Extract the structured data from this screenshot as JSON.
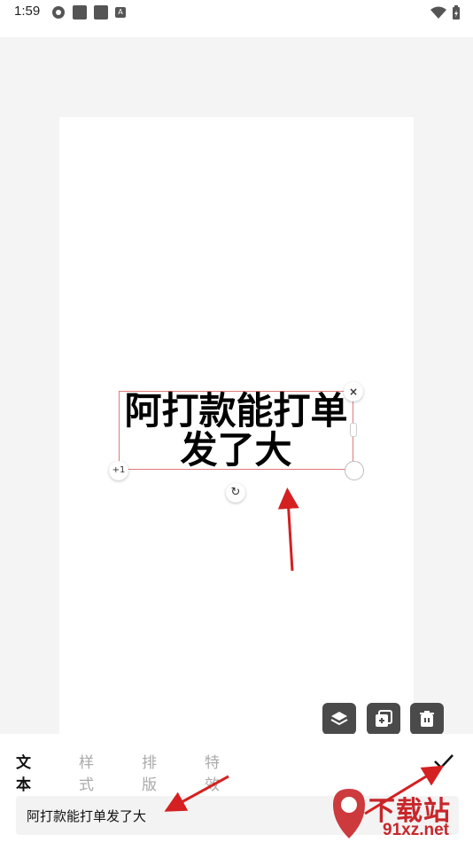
{
  "status_bar": {
    "time": "1:59",
    "notification_letter": "A"
  },
  "canvas": {
    "text_element": {
      "line1": "阿打款能打单",
      "line2": "发了大"
    },
    "handles": {
      "close": "×",
      "plus": "+1",
      "rotate": "↻"
    }
  },
  "toolbar_icons": [
    "layers-icon",
    "duplicate-icon",
    "delete-icon"
  ],
  "bottom_panel": {
    "tabs": [
      {
        "label": "文本",
        "active": true
      },
      {
        "label": "样式",
        "active": false
      },
      {
        "label": "排版",
        "active": false
      },
      {
        "label": "特效",
        "active": false
      }
    ],
    "input_value": "阿打款能打单发了大"
  },
  "watermark": {
    "title": "下载站",
    "url": "91xz.net"
  },
  "colors": {
    "accent_red": "#d42020",
    "text_box_border": "#e27a7a",
    "tool_button": "#4a4a4a"
  }
}
